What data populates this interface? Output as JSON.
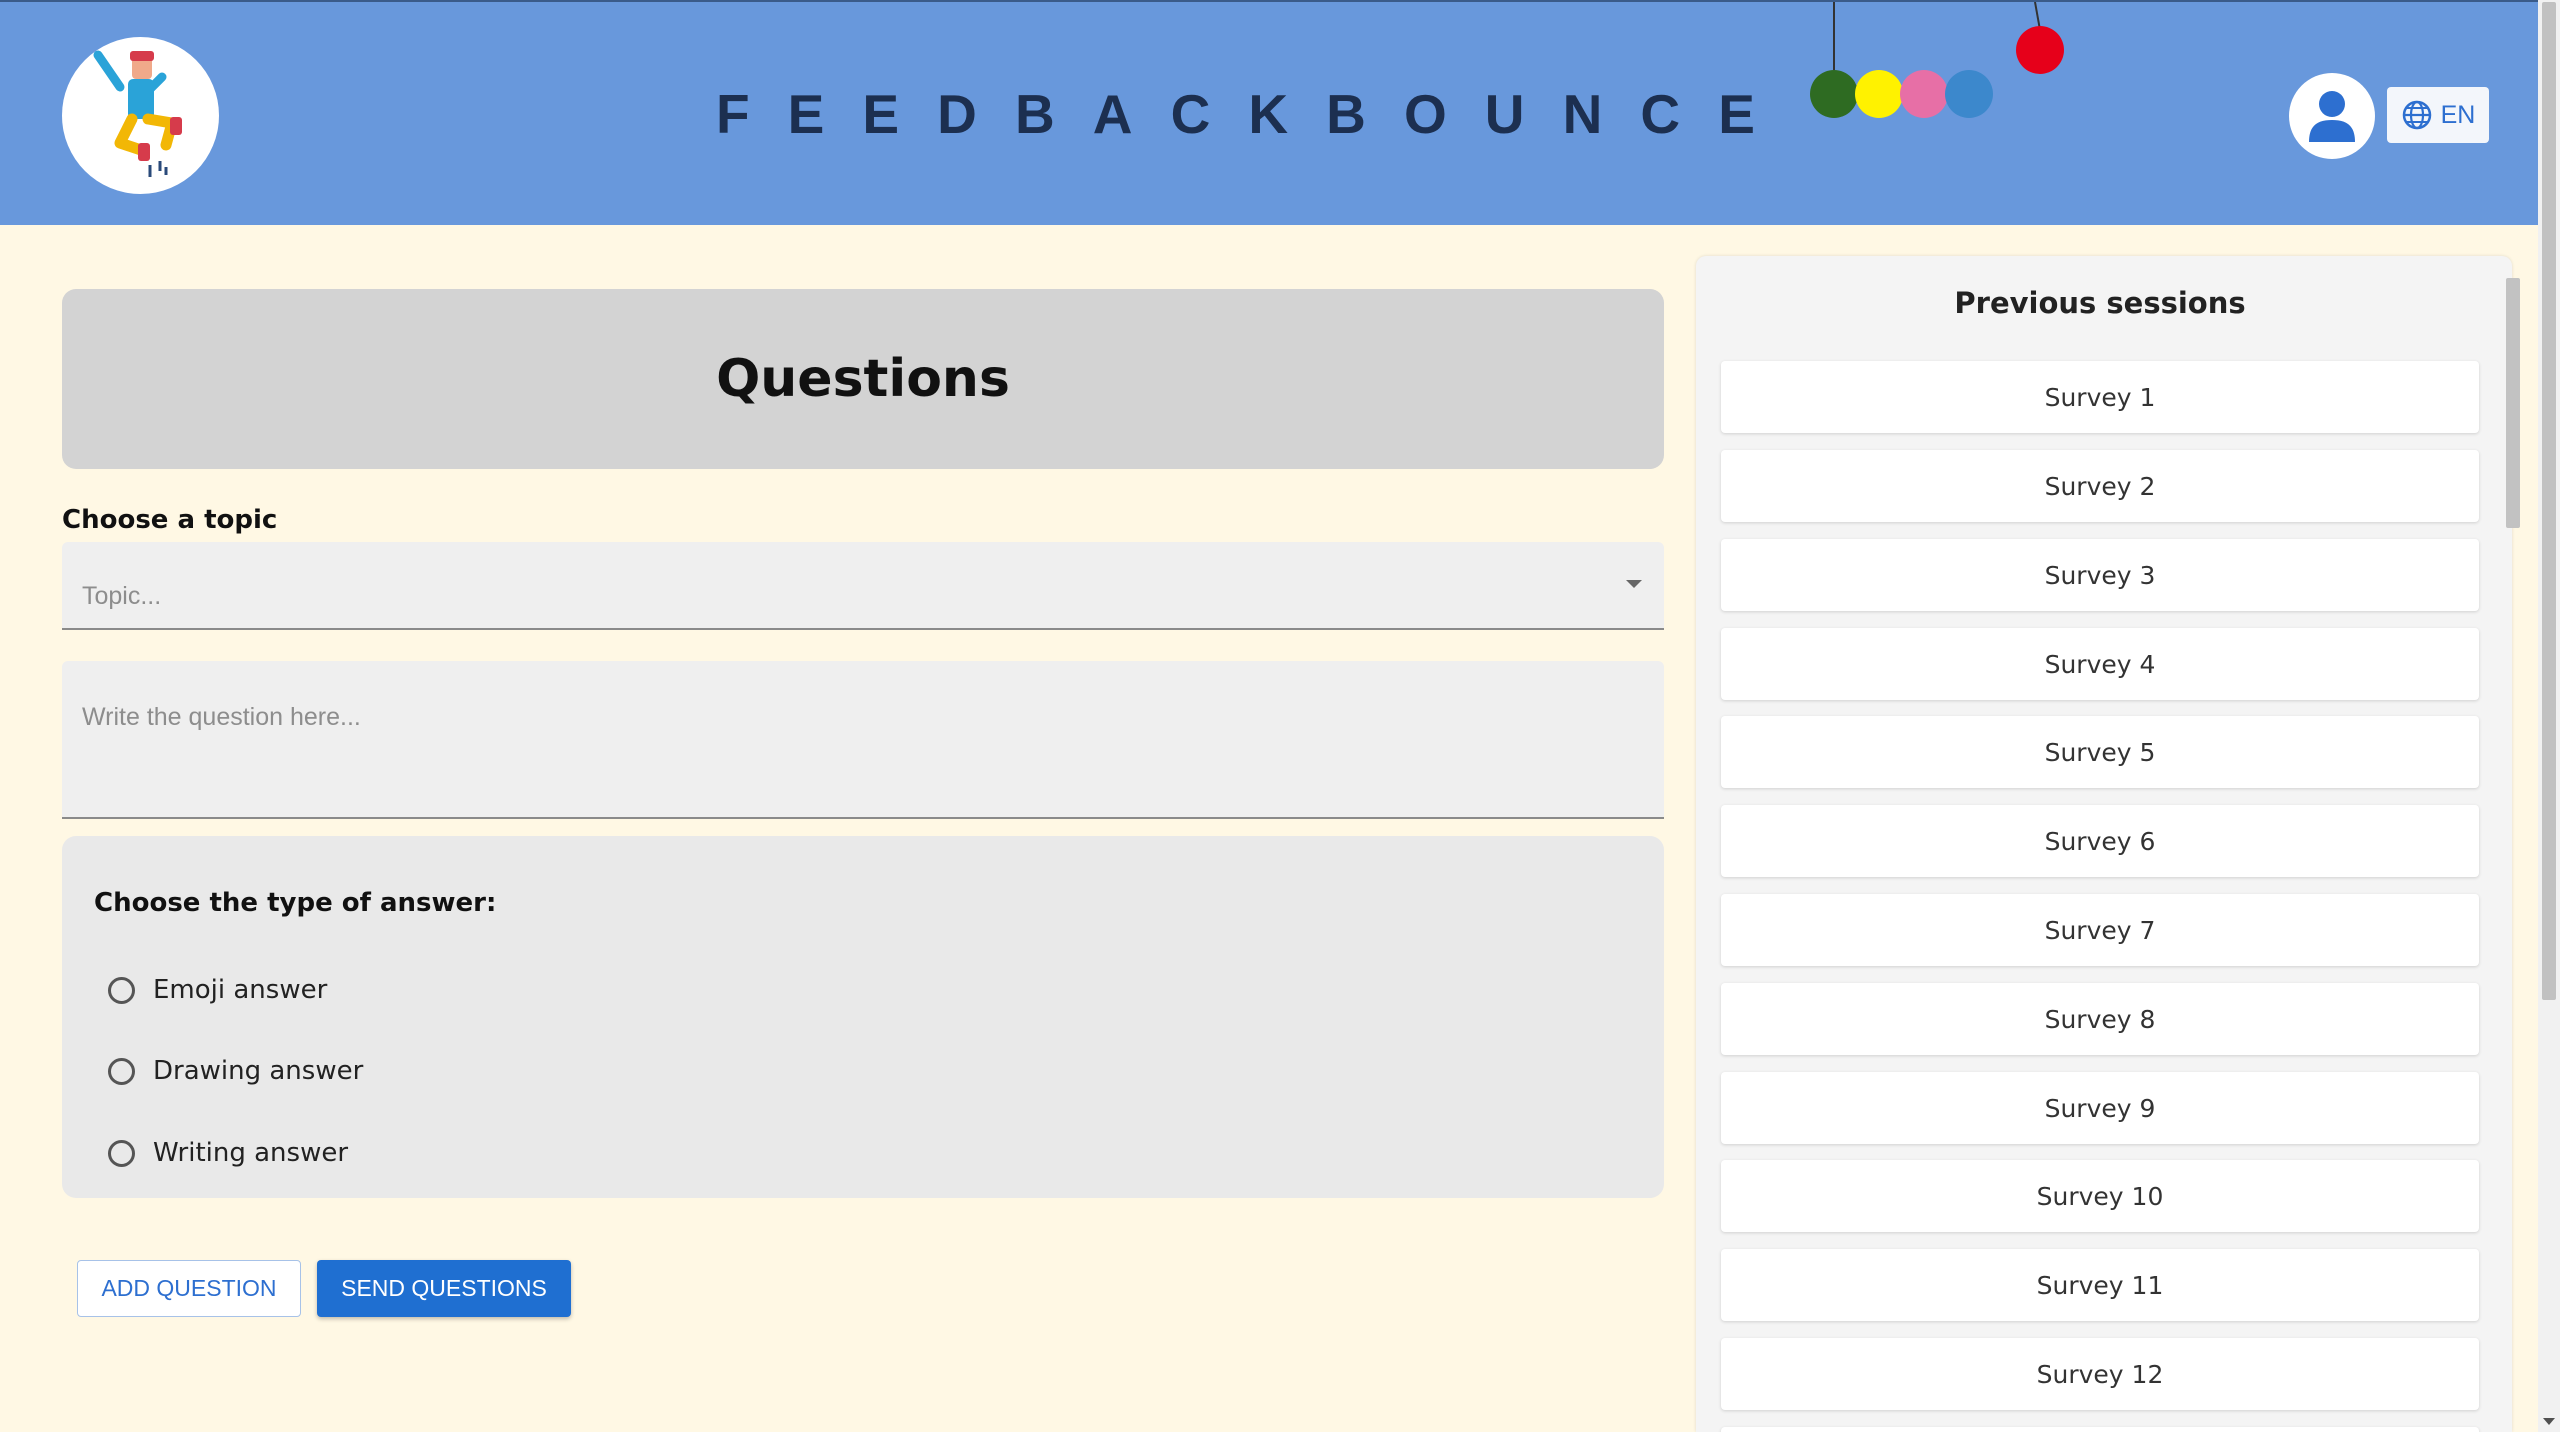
{
  "header": {
    "brand_letters": [
      "F",
      "E",
      "E",
      "D",
      "B",
      "A",
      "C",
      "K",
      "B",
      "O",
      "U",
      "N",
      "C",
      "E"
    ],
    "language_label": "EN",
    "ball_colors": [
      "#2e6b22",
      "#fff200",
      "#e76fa6",
      "#3c88cc",
      "#e6001a"
    ]
  },
  "questions": {
    "title": "Questions",
    "topic_label": "Choose a topic",
    "topic_placeholder": "Topic...",
    "question_placeholder": "Write the question here...",
    "answer_type_title": "Choose the type of answer:",
    "answer_options": [
      "Emoji answer",
      "Drawing answer",
      "Writing answer"
    ],
    "add_button": "ADD QUESTION",
    "send_button": "SEND QUESTIONS"
  },
  "sessions": {
    "title": "Previous sessions",
    "items": [
      "Survey 1",
      "Survey 2",
      "Survey 3",
      "Survey 4",
      "Survey 5",
      "Survey 6",
      "Survey 7",
      "Survey 8",
      "Survey 9",
      "Survey 10",
      "Survey 11",
      "Survey 12"
    ]
  },
  "colors": {
    "header_bg": "#6898dc",
    "page_bg": "#fff8e4",
    "primary_button": "#1f6fd1"
  }
}
